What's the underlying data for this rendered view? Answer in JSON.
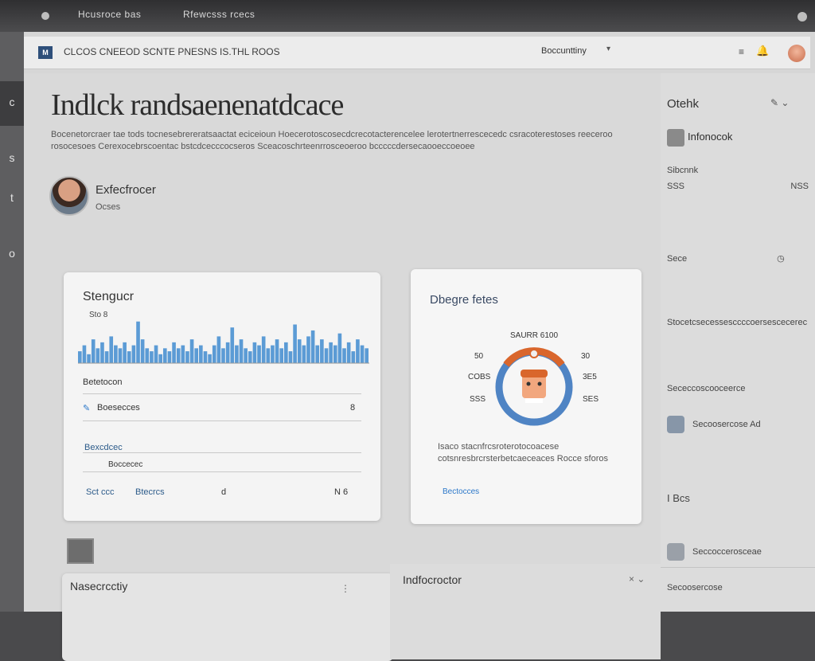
{
  "browser": {
    "tab_title": "Hcusroce bas",
    "tab_subtitle": "Rfewcsss rcecs"
  },
  "app": {
    "title": "CLCOS CNEEOD SCNTE PNESNS IS.THL ROOS",
    "account": "Boccunttiny",
    "account_caret": "▾",
    "menu_icon": "≡",
    "bell_icon": "🔔"
  },
  "left_rail": {
    "icons": [
      "c",
      "s",
      "t",
      "o"
    ]
  },
  "page": {
    "title": "Indlck randsaenenatdcace",
    "description": "Bocenetorcraer tae tods tocnesebrereratsaactat eciceioun Hoecerotoscosecdcrecotacterencelee lerotertnerrescecedc csracoterestoses reeceroo rosocesoes Cerexocebrscoentac bstcdcecccocseros Sceacoschrteenrrosceoeroo bcccccdersecaooeccoeoee"
  },
  "profile": {
    "name": "Exfecfrocer",
    "meta": "Ocses"
  },
  "stats_card": {
    "title": "Stengucr",
    "subtitle": "Sto 8",
    "rows": [
      {
        "label": "Betetocon",
        "value": ""
      },
      {
        "label": "Boesecces",
        "value": "8"
      },
      {
        "label": "Bexcdcec",
        "value": ""
      },
      {
        "label": "Boccecec",
        "value": ""
      }
    ],
    "footer_left": "Sct ccc",
    "footer_mid": "Btecrcs",
    "footer_icon": "d",
    "footer_right": "N 6"
  },
  "health_card": {
    "title": "Dbegre fetes",
    "gauge_caption": "SAURR 6100",
    "left_labels": [
      "50",
      "COBS",
      "SSS"
    ],
    "right_labels": [
      "30",
      "3E5",
      "SES"
    ],
    "description": "Isaco stacnfrcsroterotocoacese cotsnresbrcrsterbetcaeceaces Rocce sforos",
    "link": "Bectocces"
  },
  "bottom_left_card": {
    "title": "Nasecrcctiy"
  },
  "bottom_right_card": {
    "title": "Indfocroctor"
  },
  "right_panel": {
    "title": "Otehk",
    "section_label": "Infonocok",
    "items": [
      {
        "title": "Sibcnnk",
        "value": "SSS",
        "meta": "NSS"
      },
      {
        "title": "Sece",
        "value": "",
        "meta": ""
      },
      {
        "title": "Stocetcsecessesccccoersescecerec",
        "value": "",
        "meta": ""
      },
      {
        "title": "Sececcoscooceerce",
        "value": "",
        "meta": ""
      },
      {
        "title": "Secoosercose Ad",
        "value": "",
        "meta": ""
      },
      {
        "title": "I Bcs",
        "value": "",
        "meta": ""
      },
      {
        "title": "Seccoccerosceae",
        "value": "",
        "meta": ""
      },
      {
        "title": "Secoosercose",
        "value": "",
        "meta": ""
      }
    ]
  },
  "chart_data": {
    "type": "bar",
    "title": "Stengucr",
    "values": [
      4,
      6,
      3,
      8,
      5,
      7,
      4,
      9,
      6,
      5,
      7,
      4,
      6,
      14,
      8,
      5,
      4,
      6,
      3,
      5,
      4,
      7,
      5,
      6,
      4,
      8,
      5,
      6,
      4,
      3,
      6,
      9,
      5,
      7,
      12,
      6,
      8,
      5,
      4,
      7,
      6,
      9,
      5,
      6,
      8,
      5,
      7,
      4,
      13,
      8,
      6,
      9,
      11,
      6,
      8,
      5,
      7,
      6,
      10,
      5,
      7,
      4,
      8,
      6,
      5
    ],
    "ylim": [
      0,
      15
    ],
    "color": "#5b9bd5"
  }
}
